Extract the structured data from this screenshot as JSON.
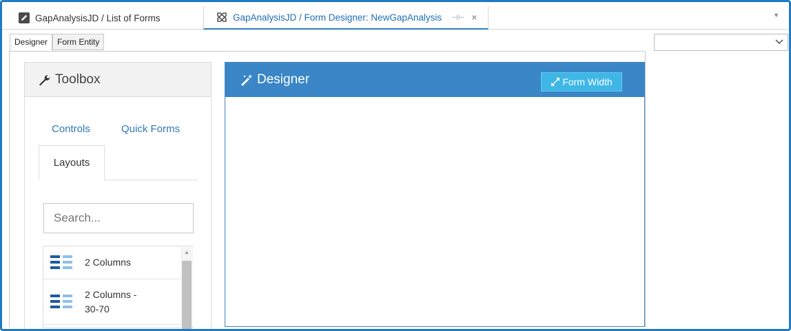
{
  "doc_tabs": [
    {
      "label": "GapAnalysisJD / List of Forms"
    },
    {
      "label": "GapAnalysisJD / Form Designer: NewGapAnalysis",
      "pin": "⊣⊢",
      "close": "×"
    }
  ],
  "inner_tabs": [
    {
      "label": "Designer"
    },
    {
      "label": "Form Entity"
    }
  ],
  "toolbox": {
    "title": "Toolbox",
    "links": {
      "controls": "Controls",
      "quick_forms": "Quick Forms"
    },
    "active_tab": "Layouts",
    "search_placeholder": "Search...",
    "items": [
      {
        "label": "2 Columns"
      },
      {
        "label_line1": "2 Columns -",
        "label_line2": "30-70"
      }
    ]
  },
  "designer": {
    "title": "Designer",
    "form_width_label": "Form Width"
  },
  "colors": {
    "accent": "#3a86c6",
    "button": "#3fb7e6",
    "link": "#2e78b8",
    "frame": "#1f7ac4"
  },
  "icons": {
    "tab1": "edit-icon",
    "tab2": "tools-icon",
    "toolbox": "wrench-icon",
    "designer": "magic-wand-icon",
    "form_width": "resize-icon",
    "layout": "columns-layout-icon"
  }
}
